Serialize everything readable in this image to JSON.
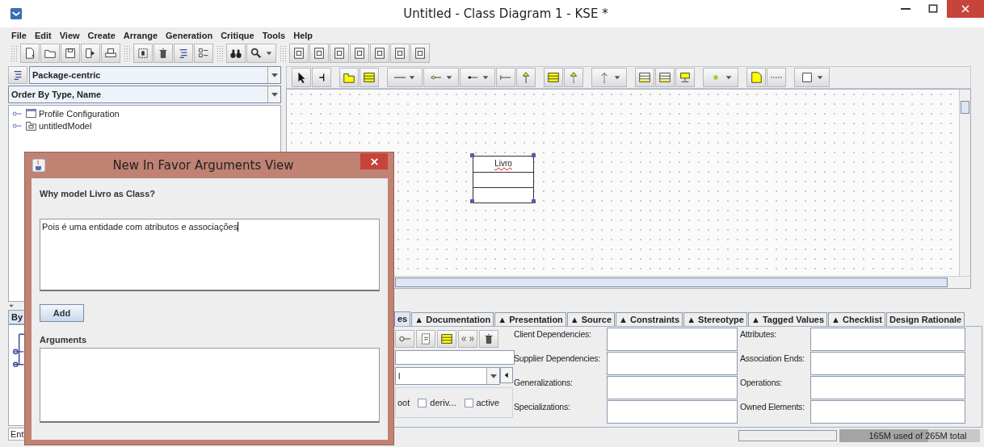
{
  "window": {
    "title": "Untitled - Class Diagram 1 - KSE *"
  },
  "menu": [
    "File",
    "Edit",
    "View",
    "Create",
    "Arrange",
    "Generation",
    "Critique",
    "Tools",
    "Help"
  ],
  "navigator": {
    "perspective": "Package-centric",
    "order": "Order By Type, Name",
    "tree": [
      {
        "label": "Profile Configuration",
        "kind": "profile"
      },
      {
        "label": "untitledModel",
        "kind": "model"
      }
    ]
  },
  "lower_navigator": {
    "tab": "By",
    "field": "Ent"
  },
  "diagram": {
    "classes": [
      {
        "name": "Livro",
        "selected": true
      }
    ]
  },
  "properties": {
    "tabs": [
      {
        "label": "es",
        "selected": true
      },
      {
        "label": "▲ Documentation",
        "selected": false
      },
      {
        "label": "▲ Presentation",
        "selected": false
      },
      {
        "label": "▲ Source",
        "selected": false
      },
      {
        "label": "▲ Constraints",
        "selected": false
      },
      {
        "label": "▲ Stereotype",
        "selected": false
      },
      {
        "label": "▲ Tagged Values",
        "selected": false
      },
      {
        "label": "▲ Checklist",
        "selected": false
      },
      {
        "label": "Design Rationale",
        "selected": false
      }
    ],
    "combo_value": "l",
    "checkboxes": [
      {
        "label": "oot"
      },
      {
        "label": "deriv...",
        "checked": false
      },
      {
        "label": "active",
        "checked": false
      }
    ],
    "fields_left": [
      "Client Dependencies:",
      "Supplier Dependencies:",
      "Generalizations:",
      "Specializations:"
    ],
    "fields_right": [
      "Attributes:",
      "Association Ends:",
      "Operations:",
      "Owned Elements:"
    ]
  },
  "status_bar": {
    "memory": "165M used of 265M total",
    "level": 0.63
  },
  "dialog": {
    "title": "New In Favor Arguments View",
    "question": "Why model Livro as Class?",
    "answer": "Pois é uma entidade com atributos e associações",
    "button": "Add",
    "list_label": "Arguments"
  }
}
